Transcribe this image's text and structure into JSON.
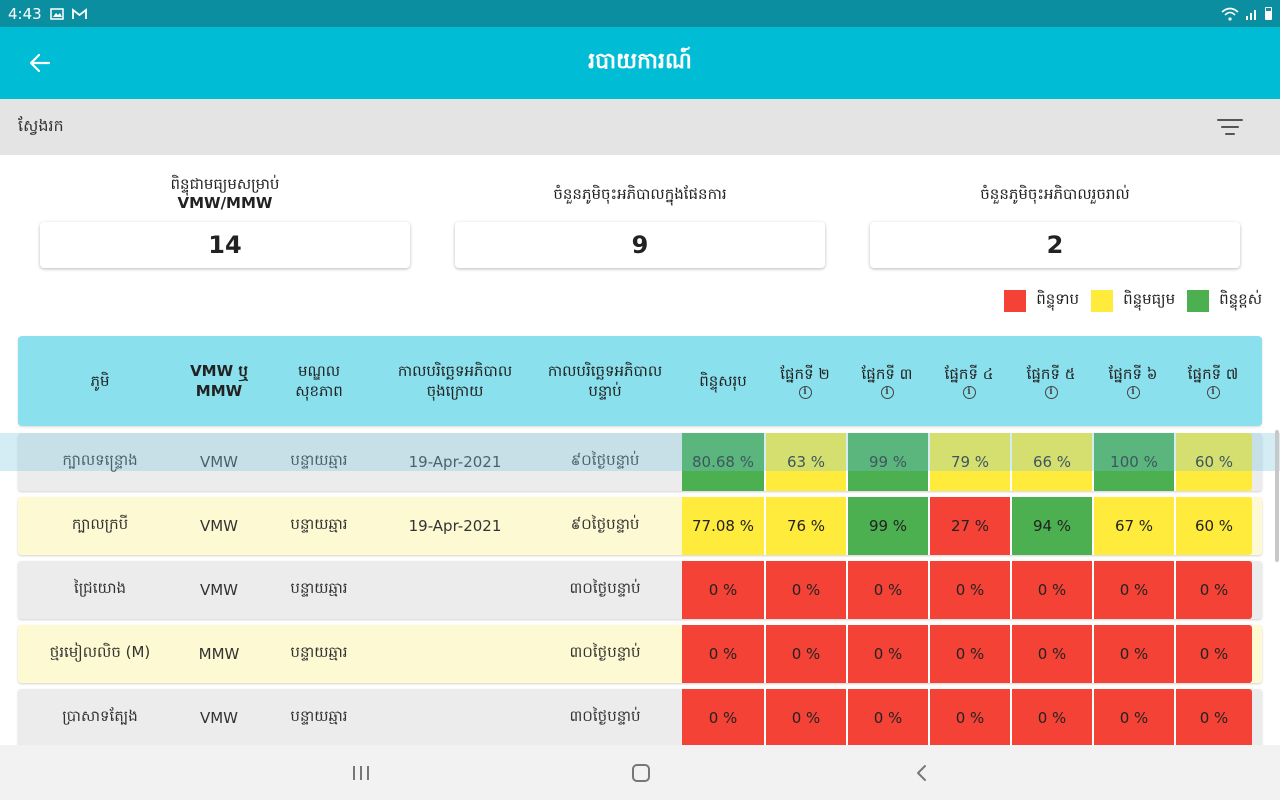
{
  "status_bar": {
    "time": "4:43",
    "left_icons": [
      "image-icon",
      "gmail-icon"
    ],
    "right_icons": [
      "wifi-icon",
      "signal-icon",
      "battery-icon"
    ]
  },
  "app_bar": {
    "title": "របាយការណ៍",
    "back_icon": "arrow-left-icon"
  },
  "search": {
    "label": "ស្វែងរក",
    "filter_icon": "filter-icon"
  },
  "summary": [
    {
      "label_line1": "ពិន្ទុជាមធ្យមសម្រាប់",
      "label_line2": "VMW/MMW",
      "value": "14"
    },
    {
      "label_line1": "ចំនួនភូមិចុះអភិបាលក្នុងផែនការ",
      "label_line2": "",
      "value": "9"
    },
    {
      "label_line1": "ចំនួនភូមិចុះអភិបាលរួចរាល់",
      "label_line2": "",
      "value": "2"
    }
  ],
  "legend": [
    {
      "label": "ពិន្ទុទាប",
      "color": "#f44336"
    },
    {
      "label": "ពិន្ទុមធ្យម",
      "color": "#ffeb3b"
    },
    {
      "label": "ពិន្ទុខ្ពស់",
      "color": "#4caf50"
    }
  ],
  "table": {
    "headers": {
      "village": "ភូមិ",
      "type_line1": "VMW ឬ",
      "type_line2": "MMW",
      "center_line1": "មណ្ឌល",
      "center_line2": "សុខភាព",
      "last_line1": "កាលបរិច្ឆេទអភិបាល",
      "last_line2": "ចុងក្រោយ",
      "next_line1": "កាលបរិច្ឆេទអភិបាល",
      "next_line2": "បន្ទាប់",
      "total": "ពិន្ទុសរុប",
      "s2": "ផ្នែកទី ២",
      "s3": "ផ្នែកទី ៣",
      "s4": "ផ្នែកទី ៤",
      "s5": "ផ្នែកទី ៥",
      "s6": "ផ្នែកទី ៦",
      "s7": "ផ្នែកទី ៧"
    },
    "rows": [
      {
        "village": "ក្បាលទន្ទ្រោង",
        "type": "VMW",
        "center": "បន្ទាយឆ្មារ",
        "last": "19-Apr-2021",
        "next": "៩០ថ្ងៃបន្ទាប់",
        "scores": [
          "80.68 %",
          "63 %",
          "99 %",
          "79 %",
          "66 %",
          "100 %",
          "60 %"
        ],
        "colors": [
          "green",
          "yellow",
          "green",
          "yellow",
          "yellow",
          "green",
          "yellow"
        ]
      },
      {
        "village": "ក្បាលក្របី",
        "type": "VMW",
        "center": "បន្ទាយឆ្មារ",
        "last": "19-Apr-2021",
        "next": "៩០ថ្ងៃបន្ទាប់",
        "scores": [
          "77.08 %",
          "76 %",
          "99 %",
          "27 %",
          "94 %",
          "67 %",
          "60 %"
        ],
        "colors": [
          "yellow",
          "yellow",
          "green",
          "red",
          "green",
          "yellow",
          "yellow"
        ]
      },
      {
        "village": "ជ្រៃយោង",
        "type": "VMW",
        "center": "បន្ទាយឆ្មារ",
        "last": "",
        "next": "៣០ថ្ងៃបន្ទាប់",
        "scores": [
          "0 %",
          "0 %",
          "0 %",
          "0 %",
          "0 %",
          "0 %",
          "0 %"
        ],
        "colors": [
          "red",
          "red",
          "red",
          "red",
          "red",
          "red",
          "red"
        ]
      },
      {
        "village": "ថ្មរមៀលលិច (M)",
        "type": "MMW",
        "center": "បន្ទាយឆ្មារ",
        "last": "",
        "next": "៣០ថ្ងៃបន្ទាប់",
        "scores": [
          "0 %",
          "0 %",
          "0 %",
          "0 %",
          "0 %",
          "0 %",
          "0 %"
        ],
        "colors": [
          "red",
          "red",
          "red",
          "red",
          "red",
          "red",
          "red"
        ]
      },
      {
        "village": "ប្រាសាទត្បែង",
        "type": "VMW",
        "center": "បន្ទាយឆ្មារ",
        "last": "",
        "next": "៣០ថ្ងៃបន្ទាប់",
        "scores": [
          "0 %",
          "0 %",
          "0 %",
          "0 %",
          "0 %",
          "0 %",
          "0 %"
        ],
        "colors": [
          "red",
          "red",
          "red",
          "red",
          "red",
          "red",
          "red"
        ]
      }
    ]
  },
  "nav_bar": {
    "icons": [
      "recents-icon",
      "home-icon",
      "back-icon"
    ]
  }
}
